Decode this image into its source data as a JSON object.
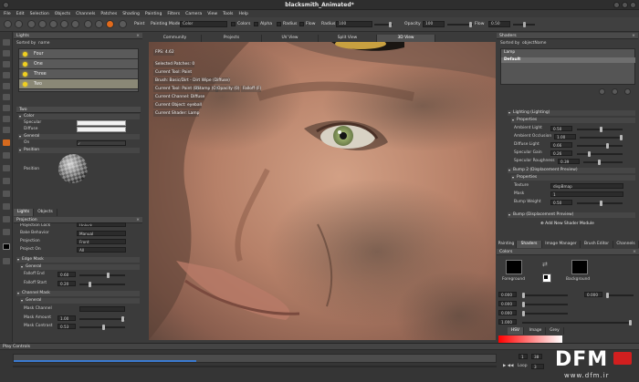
{
  "window": {
    "title": "blacksmith_Animated*"
  },
  "menu": [
    "File",
    "Edit",
    "Selection",
    "Objects",
    "Channels",
    "Patches",
    "Shading",
    "Painting",
    "Filters",
    "Camera",
    "View",
    "Tools",
    "Help"
  ],
  "toolbar": {
    "paint_label": "Paint",
    "painting_mode_label": "Painting Mode",
    "painting_mode_value": "Color",
    "colors_label": "Colors",
    "alpha_label": "Alpha",
    "radius_label": "Radius",
    "flow_label": "Flow",
    "radius_value": "100",
    "opacity_label": "Opacity",
    "opacity_value": "100",
    "flow2_label": "Flow",
    "flow_value": "0.50"
  },
  "layers_panel": {
    "title": "Lights",
    "sort_label": "Sorted by",
    "sort_value": "name",
    "items": [
      "Four",
      "One",
      "Three",
      "Two"
    ],
    "selected_index": 3
  },
  "properties_panel": {
    "title": "Two",
    "color_section": "Color",
    "specular_label": "Specular",
    "diffuse_label": "Diffuse",
    "general_section": "General",
    "on_label": "On",
    "position_section": "Position",
    "position_label": "Position"
  },
  "left_tabs": [
    "Lights",
    "Objects"
  ],
  "projection_panel": {
    "title": "Projection",
    "rows": [
      {
        "label": "Projection Lock",
        "value": "Unlock"
      },
      {
        "label": "Bake Behavior",
        "value": "Manual"
      },
      {
        "label": "Projection",
        "value": "Front"
      },
      {
        "label": "Project On",
        "value": "All"
      }
    ],
    "edge_mask_section": "Edge Mask",
    "general_section": "General",
    "falloff_end_label": "Falloff End",
    "falloff_end_value": "0.60",
    "falloff_start_label": "Falloff Start",
    "falloff_start_value": "0.20",
    "channel_mask_section": "Channel Mask",
    "general2_section": "General",
    "mask_channel_label": "Mask Channel",
    "mask_amount_label": "Mask Amount",
    "mask_amount_value": "1.00",
    "mask_contrast_label": "Mask Contrast",
    "mask_contrast_value": "0.53"
  },
  "viewport_tabs": [
    "Community",
    "Projects",
    "UV View",
    "Split View",
    "3D View"
  ],
  "viewport_active_tab": 4,
  "hud": {
    "fps": "FPS: 4.62",
    "lines": [
      "Selected Patches: 0",
      "Current Tool: Paint",
      "Brush: Basic/Dirt - Dirt Wipe (Diffuse)",
      "Current Channel: Diffuse",
      "Current Object: eyeball",
      "Current Shader: Lamp"
    ],
    "tool_line": "Current Tool: Paint (B)",
    "tool_line_extras": [
      "Stamp (O)",
      "Opacity (0)",
      "Falloff (F)"
    ]
  },
  "shaders_panel": {
    "title": "Shaders",
    "sort_label": "Sorted by",
    "sort_value": "objectName",
    "items": [
      "Lamp",
      "Default"
    ],
    "lighting_section": "Lighting (Lighting)",
    "properties_section": "Properties",
    "rows": [
      {
        "label": "Ambient Light",
        "value": "0.50"
      },
      {
        "label": "Ambient Occlusion",
        "value": "1.00"
      },
      {
        "label": "Diffuse Light",
        "value": "0.66"
      },
      {
        "label": "Specular Gain",
        "value": "0.26"
      },
      {
        "label": "Specular Roughness",
        "value": "0.39"
      }
    ],
    "bump_section": "Bump 2 (Displacement Preview)",
    "bump_properties": "Properties",
    "texture_label": "Texture",
    "texture_value": "dispBmap",
    "mask_label": "Mask",
    "mask_value": "1",
    "bump_weight_label": "Bump Weight",
    "bump_weight_value": "0.50",
    "bump_preview_section": "Bump (Displacement Preview)",
    "add_button": "Add New Shader Module"
  },
  "right_tabs": [
    "Painting",
    "Shaders",
    "Image Manager",
    "Brush Editor",
    "Channels"
  ],
  "right_active_tab": 1,
  "colors_panel": {
    "title": "Colors",
    "foreground_label": "Foreground",
    "background_label": "Background",
    "values": [
      "0.000",
      "0.000",
      "0.000",
      "0.000",
      "1.000"
    ],
    "mode_tabs": [
      "HSV",
      "Image",
      "Grey"
    ]
  },
  "playback": {
    "title": "Play Controls",
    "frame_start": "1",
    "frame_end": "38",
    "loop_label": "Loop",
    "frame_current": "3"
  },
  "watermark": {
    "brand": "DFM",
    "url": "www.dfm.ir"
  }
}
